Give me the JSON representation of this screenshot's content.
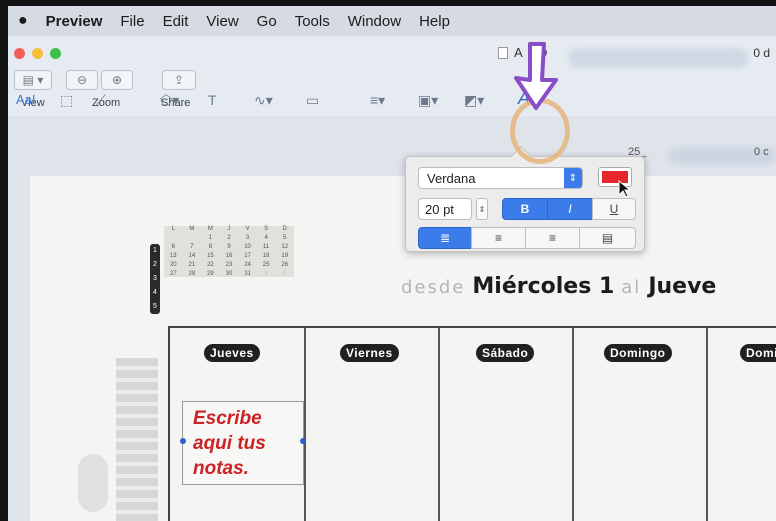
{
  "menubar": {
    "apple_icon": "apple-icon",
    "app_name": "Preview",
    "items": [
      "File",
      "Edit",
      "View",
      "Go",
      "Tools",
      "Window",
      "Help"
    ]
  },
  "window": {
    "title_fragment": "A",
    "title_suffix": "ND",
    "right_readout": "0 d",
    "ruler_readout": "25_",
    "ruler_right": "0 c"
  },
  "toolbar": {
    "view_label": "View",
    "zoom_label": "Zoom",
    "share_label": "Share",
    "text_style_label": "AaI"
  },
  "font_popover": {
    "font_name": "Verdana",
    "font_size": "20 pt",
    "bold_label": "B",
    "italic_label": "I",
    "underline_label": "U",
    "text_color": "#e5262d",
    "bold_on": true,
    "italic_on": true,
    "alignment": "left"
  },
  "document": {
    "weekday_letters": [
      "L",
      "M",
      "M",
      "J",
      "V",
      "S",
      "D"
    ],
    "week_numbers": [
      "1",
      "2",
      "3",
      "4",
      "5"
    ],
    "mini_calendar": [
      [
        "",
        "",
        "1",
        "2",
        "3",
        "4",
        "5"
      ],
      [
        "6",
        "7",
        "8",
        "9",
        "10",
        "11",
        "12"
      ],
      [
        "13",
        "14",
        "15",
        "16",
        "17",
        "18",
        "19"
      ],
      [
        "20",
        "21",
        "22",
        "23",
        "24",
        "25",
        "26"
      ],
      [
        "27",
        "28",
        "29",
        "30",
        "31",
        "1",
        "2"
      ]
    ],
    "range_from": "desde",
    "range_start": "Miércoles 1",
    "range_to": "al",
    "range_end": "Jueve",
    "days": [
      "Jueves",
      "Viernes",
      "Sábado",
      "Domingo",
      "Domin"
    ],
    "note_text": "Escribe\naqui tus\nnotas."
  },
  "colors": {
    "accent": "#3c7bea",
    "note_red": "#cc2224",
    "annotation_arrow": "#8a4dc8",
    "annotation_circle": "#e5b57c"
  }
}
